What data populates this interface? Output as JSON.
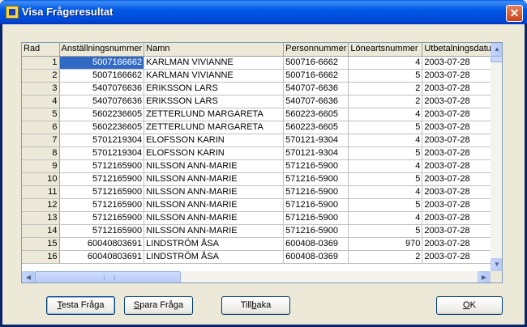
{
  "window": {
    "title": "Visa Frågeresultat",
    "close_glyph": "✕"
  },
  "grid": {
    "columns": [
      "Rad",
      "Anställningsnummer",
      "Namn",
      "Personnummer",
      "Löneartsnummer",
      "Utbetalningsdatum"
    ],
    "rows": [
      [
        "1",
        "5007166662",
        "KARLMAN VIVIANNE",
        "500716-6662",
        "4",
        "2003-07-28"
      ],
      [
        "2",
        "5007166662",
        "KARLMAN VIVIANNE",
        "500716-6662",
        "5",
        "2003-07-28"
      ],
      [
        "3",
        "5407076636",
        "ERIKSSON LARS",
        "540707-6636",
        "2",
        "2003-07-28"
      ],
      [
        "4",
        "5407076636",
        "ERIKSSON LARS",
        "540707-6636",
        "2",
        "2003-07-28"
      ],
      [
        "5",
        "5602236605",
        "ZETTERLUND MARGARETA",
        "560223-6605",
        "4",
        "2003-07-28"
      ],
      [
        "6",
        "5602236605",
        "ZETTERLUND MARGARETA",
        "560223-6605",
        "5",
        "2003-07-28"
      ],
      [
        "7",
        "5701219304",
        "ELOFSSON KARIN",
        "570121-9304",
        "4",
        "2003-07-28"
      ],
      [
        "8",
        "5701219304",
        "ELOFSSON KARIN",
        "570121-9304",
        "5",
        "2003-07-28"
      ],
      [
        "9",
        "5712165900",
        "NILSSON ANN-MARIE",
        "571216-5900",
        "4",
        "2003-07-28"
      ],
      [
        "10",
        "5712165900",
        "NILSSON ANN-MARIE",
        "571216-5900",
        "5",
        "2003-07-28"
      ],
      [
        "11",
        "5712165900",
        "NILSSON ANN-MARIE",
        "571216-5900",
        "4",
        "2003-07-28"
      ],
      [
        "12",
        "5712165900",
        "NILSSON ANN-MARIE",
        "571216-5900",
        "5",
        "2003-07-28"
      ],
      [
        "13",
        "5712165900",
        "NILSSON ANN-MARIE",
        "571216-5900",
        "4",
        "2003-07-28"
      ],
      [
        "14",
        "5712165900",
        "NILSSON ANN-MARIE",
        "571216-5900",
        "5",
        "2003-07-28"
      ],
      [
        "15",
        "60040803691",
        "LINDSTRÖM ÅSA",
        "600408-0369",
        "970",
        "2003-07-28"
      ],
      [
        "16",
        "60040803691",
        "LINDSTRÖM ÅSA",
        "600408-0369",
        "2",
        "2003-07-28"
      ]
    ]
  },
  "scrollbar": {
    "up": "▲",
    "down": "▼",
    "left": "◀",
    "right": "▶"
  },
  "buttons": {
    "testa": {
      "mnemonic": "T",
      "rest": "esta Fråga"
    },
    "spara": {
      "mnemonic": "S",
      "rest": "para Fråga"
    },
    "tillbaka": {
      "pre": "Till",
      "mnemonic": "b",
      "rest": "aka"
    },
    "ok": {
      "mnemonic": "O",
      "rest": "K"
    }
  },
  "colors": {
    "selection": "#316ac5",
    "titlebar": "#0058e6",
    "face": "#ece9d8"
  }
}
